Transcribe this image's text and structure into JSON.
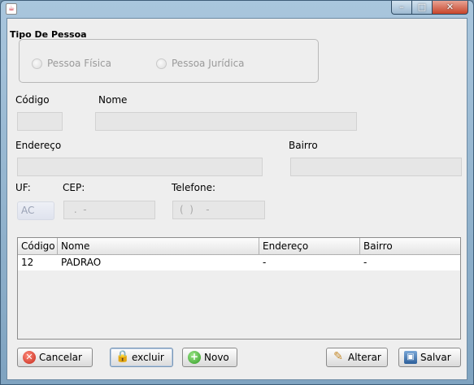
{
  "window": {
    "app_icon": "java-cup-icon",
    "minimize": "–",
    "maximize": "□",
    "close": "✕"
  },
  "tipo_pessoa": {
    "title": "Tipo De Pessoa",
    "options": [
      "Pessoa Física",
      "Pessoa Jurídica"
    ]
  },
  "labels": {
    "codigo": "Código",
    "nome": "Nome",
    "endereco": "Endereço",
    "bairro": "Bairro",
    "uf": "UF:",
    "cep": "CEP:",
    "telefone": "Telefone:"
  },
  "fields": {
    "codigo": "",
    "nome": "",
    "endereco": "",
    "bairro": "",
    "uf": "AC",
    "cep": " .  -",
    "telefone": "(  )    -"
  },
  "table": {
    "columns": [
      "Código",
      "Nome",
      "Endereço",
      "Bairro"
    ],
    "rows": [
      {
        "codigo": "12",
        "nome": "PADRAO",
        "endereco": "-",
        "bairro": "-"
      }
    ]
  },
  "buttons": {
    "cancelar": "Cancelar",
    "excluir": "excluir",
    "novo": "Novo",
    "alterar": "Alterar",
    "salvar": "Salvar"
  },
  "icons": {
    "cancelar": "cancel-icon",
    "excluir": "lock-icon",
    "novo": "add-icon",
    "alterar": "edit-icon",
    "salvar": "save-icon"
  },
  "colors": {
    "accent": "#7896b5",
    "title_bar": "#a9c6dd",
    "close_button": "#c7442a"
  }
}
